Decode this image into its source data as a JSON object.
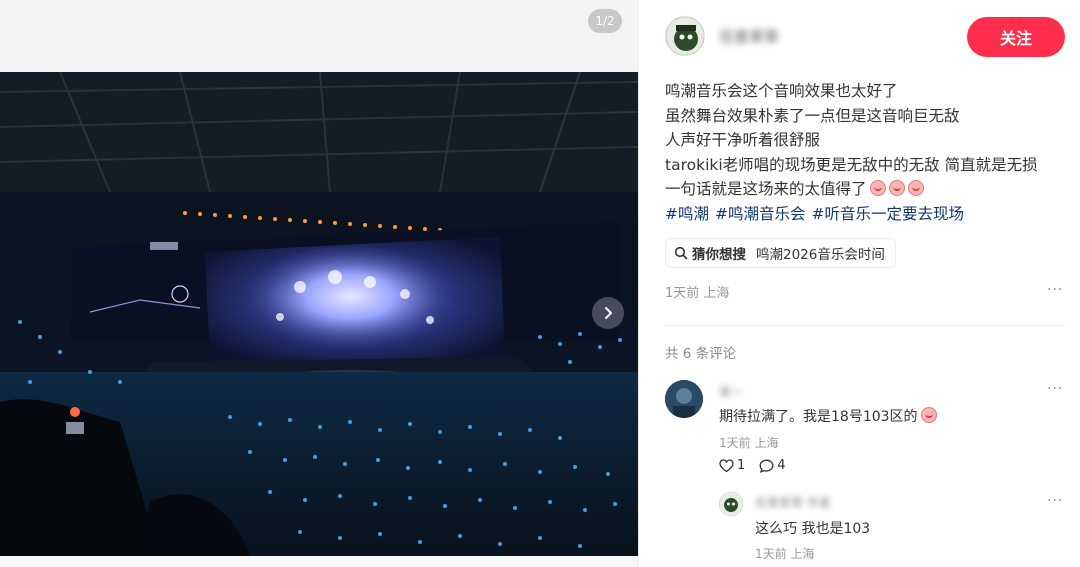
{
  "media": {
    "counter": "1/2",
    "next_icon": "chevron-right-icon"
  },
  "post": {
    "author_name": "任意草草",
    "follow_label": "关注",
    "lines": [
      "鸣潮音乐会这个音响效果也太好了",
      "虽然舞台效果朴素了一点但是这音响巨无敌",
      "人声好干净听着很舒服",
      "tarokiki老师唱的现场更是无敌中的无敌 简直就是无损",
      "一句话就是这场来的太值得了"
    ],
    "tags": [
      "#鸣潮",
      "#鸣潮音乐会",
      "#听音乐一定要去现场"
    ],
    "guess": {
      "label": "猜你想搜",
      "query": "鸣潮2026音乐会时间"
    },
    "meta": "1天前 上海",
    "more": "···"
  },
  "comments": {
    "count_label": "共 6 条评论",
    "items": [
      {
        "name": "某一",
        "text": "期待拉满了。我是18号103区的",
        "meta": "1天前 上海",
        "likes": "1",
        "replies": "4",
        "more": "···"
      }
    ],
    "reply": {
      "name": "任意草草 作者",
      "text": "这么巧 我也是103",
      "meta": "1天前 上海",
      "more": "···"
    }
  },
  "colors": {
    "accent": "#ff2e4d",
    "tag": "#13386c"
  }
}
